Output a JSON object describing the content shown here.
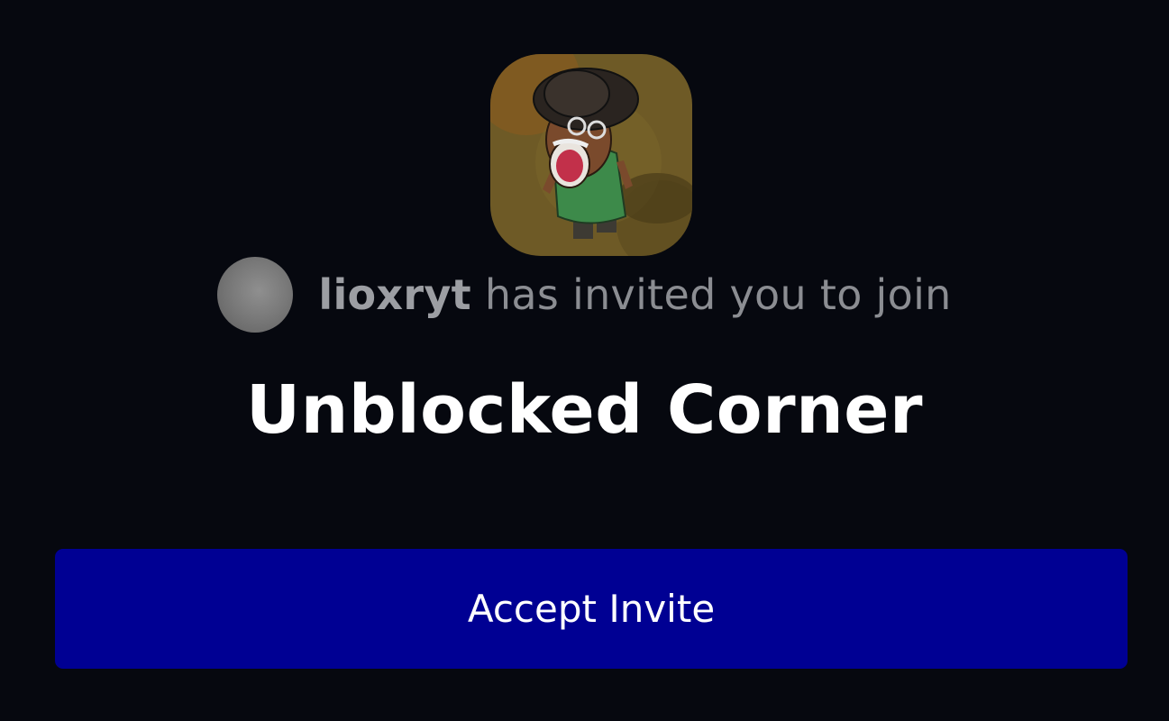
{
  "invite": {
    "inviter_name": "lioxryt",
    "message": "has invited you to join",
    "server_name": "Unblocked Corner",
    "accept_label": "Accept Invite"
  },
  "colors": {
    "background": "#06080f",
    "button": "#000093",
    "muted_text": "#8b8d92",
    "title_text": "#ffffff"
  },
  "icons": {
    "server_icon": "cartoon-man-in-bowler-hat-icon",
    "inviter_avatar": "user-avatar"
  }
}
